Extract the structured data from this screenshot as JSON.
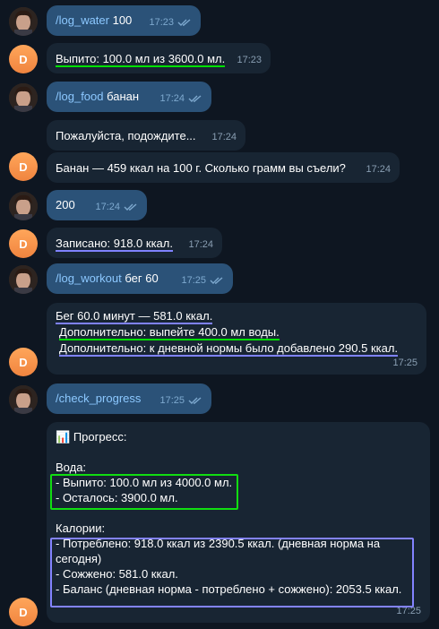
{
  "messages": [
    {
      "from": "user",
      "command": "/log_water",
      "text": " 100",
      "time": "17:23"
    },
    {
      "from": "bot",
      "text": "Выпито: 100.0 мл из 3600.0 мл.",
      "time": "17:23"
    },
    {
      "from": "user",
      "command": "/log_food",
      "text": " банан",
      "time": "17:24"
    },
    {
      "from": "bot",
      "text": "Пожалуйста, подождите...",
      "time": "17:24"
    },
    {
      "from": "bot",
      "text": "Банан — 459 ккал на 100 г. Сколько грамм вы съели?",
      "time": "17:24"
    },
    {
      "from": "user",
      "text": "200",
      "time": "17:24"
    },
    {
      "from": "bot",
      "text": "Записано: 918.0 ккал.",
      "time": "17:24"
    },
    {
      "from": "user",
      "command": "/log_workout",
      "text": " бег 60",
      "time": "17:25"
    },
    {
      "from": "bot",
      "lines": [
        "Бег 60.0 минут — 581.0 ккал.",
        "Дополнительно: выпейте 400.0 мл воды.",
        "Дополнительно: к дневной нормы было добавлено 290.5 ккал."
      ],
      "time": "17:25"
    },
    {
      "from": "user",
      "command": "/check_progress",
      "text": "",
      "time": "17:25"
    },
    {
      "from": "bot",
      "progress": {
        "header_icon": "📊",
        "header": "Прогресс:",
        "water_title": "Вода:",
        "water_lines": [
          "- Выпито: 100.0 мл из 4000.0 мл.",
          "- Осталось: 3900.0 мл."
        ],
        "cal_title": "Калории:",
        "cal_lines": [
          "- Потреблено: 918.0 ккал из 2390.5 ккал. (дневная норма на",
          "сегодня)",
          "- Сожжено: 581.0 ккал.",
          "- Баланс (дневная норма - потреблено + сожжено): 2053.5 ккал."
        ]
      },
      "time": "17:25"
    }
  ],
  "avatars": {
    "bot_letter": "D"
  },
  "colors": {
    "background": "#0e1621",
    "outgoing": "#2b5278",
    "incoming": "#182533",
    "command": "#8cc8ff",
    "highlight_green": "#11dd11",
    "highlight_blue": "#8383ff"
  }
}
